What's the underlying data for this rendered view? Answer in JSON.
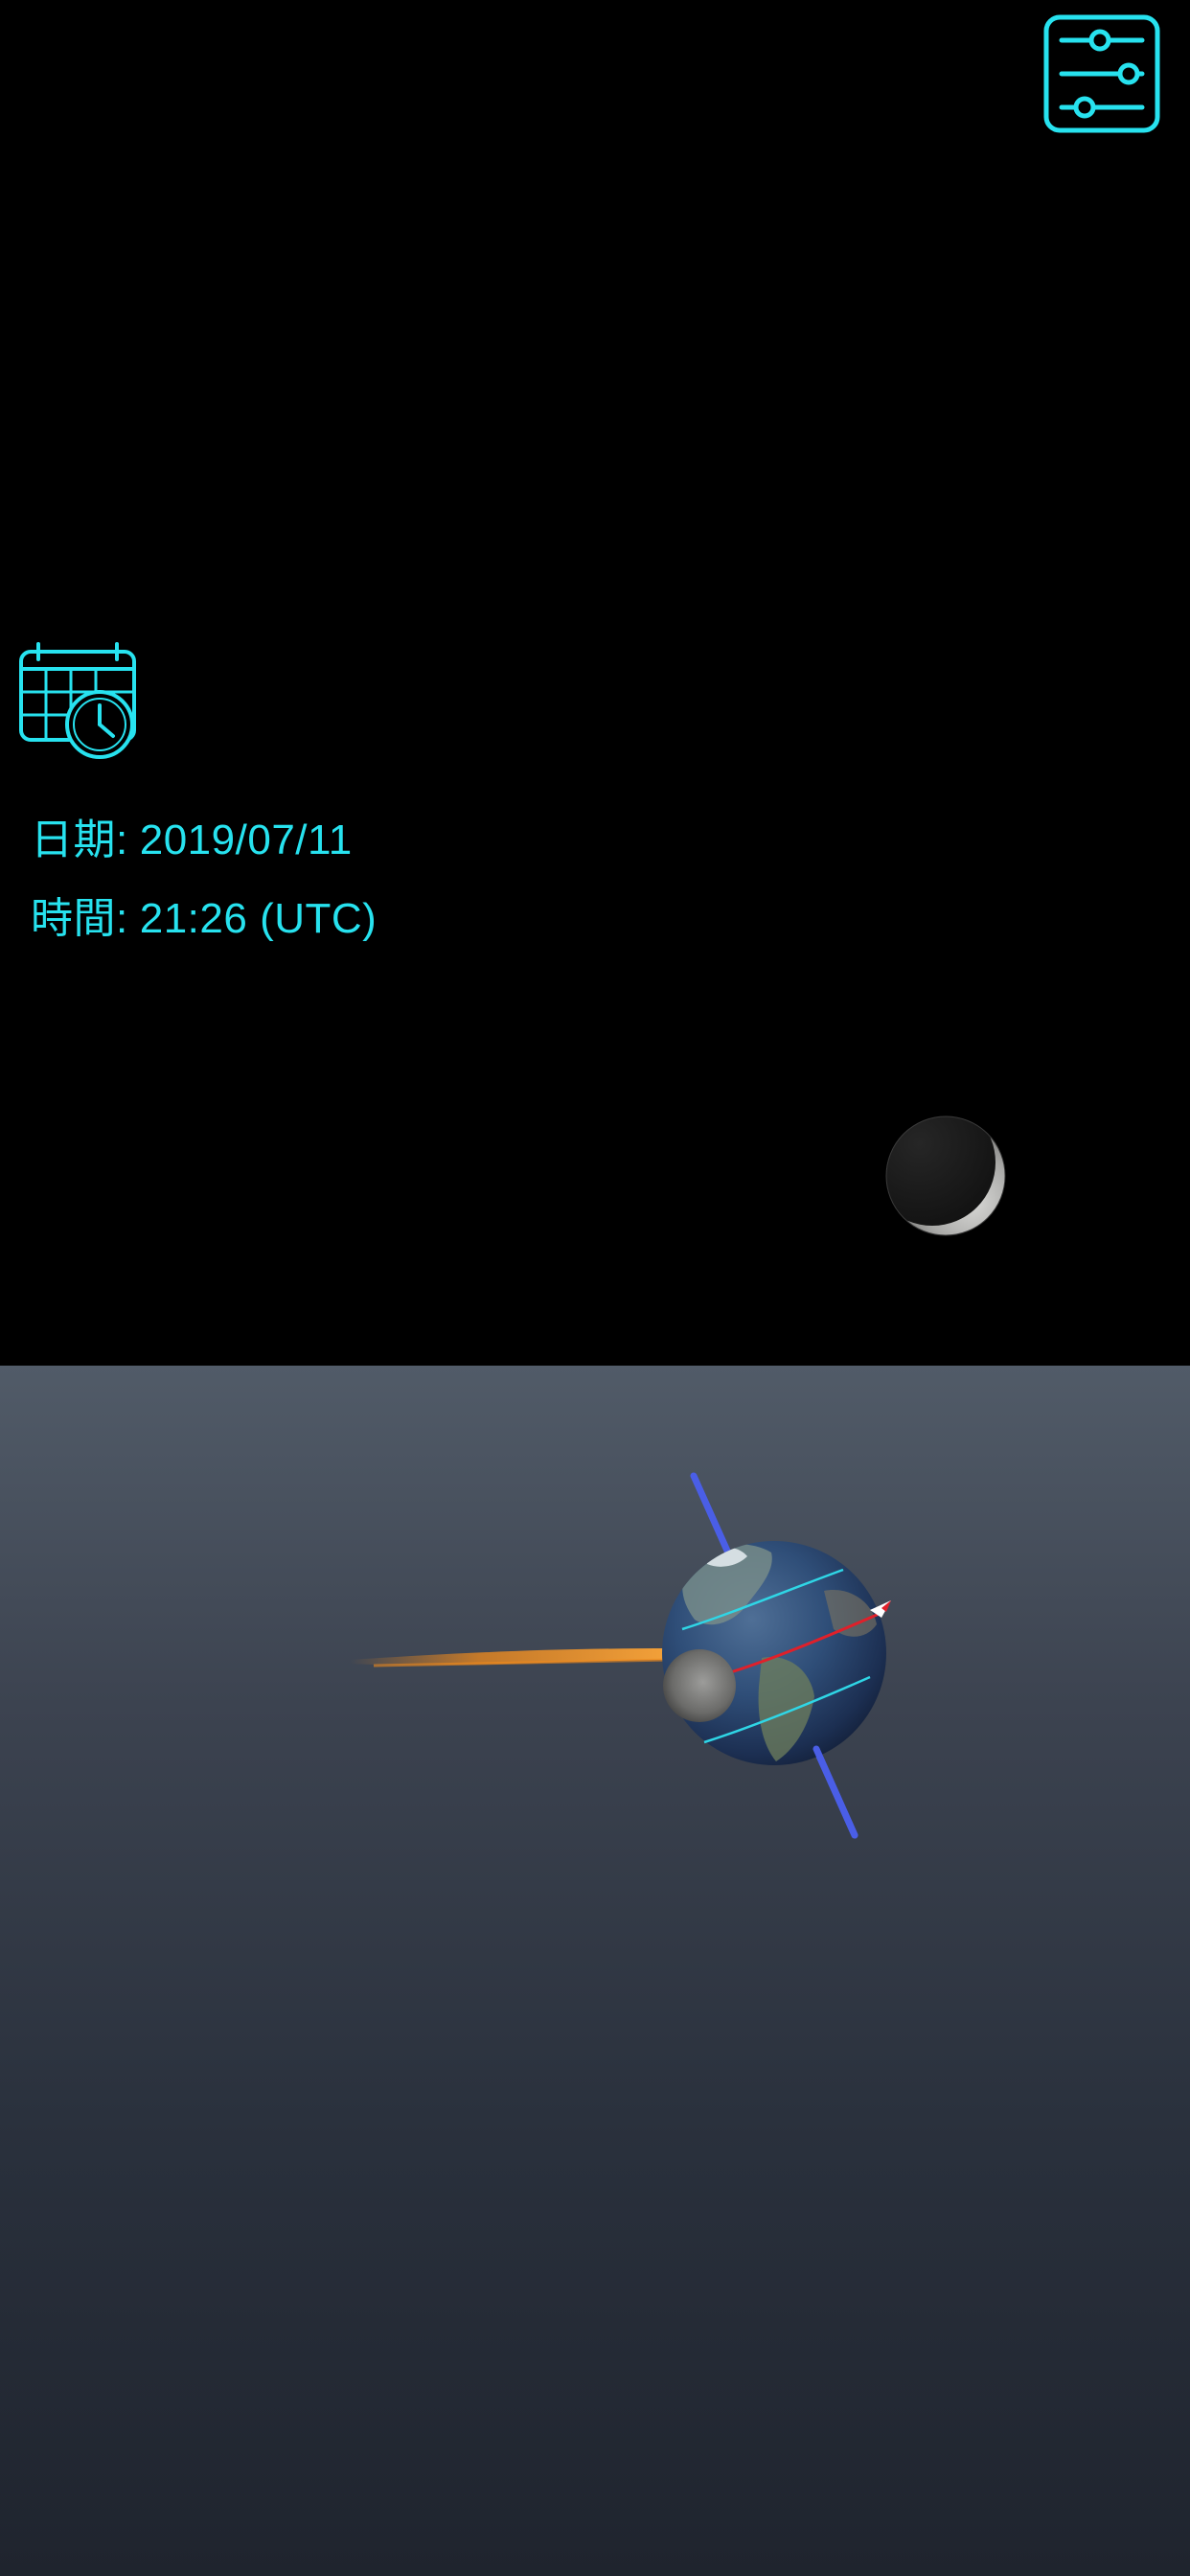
{
  "info": {
    "date_label": "日期:",
    "date_value": "2019/07/11",
    "time_label": "時間:",
    "time_value": "21:26 (UTC)"
  },
  "icons": {
    "settings": "sliders-settings-icon",
    "calendar": "calendar-clock-icon"
  },
  "colors": {
    "accent": "#27e2ef",
    "top_background": "#000000",
    "bottom_background_top": "#515b68",
    "bottom_background_bottom": "#1f242e",
    "earth_axis": "#4a5ee6",
    "equator_line": "#e0202a",
    "tropic_lines": "#2fd6e6",
    "sun_ray": "#f08a1c"
  }
}
